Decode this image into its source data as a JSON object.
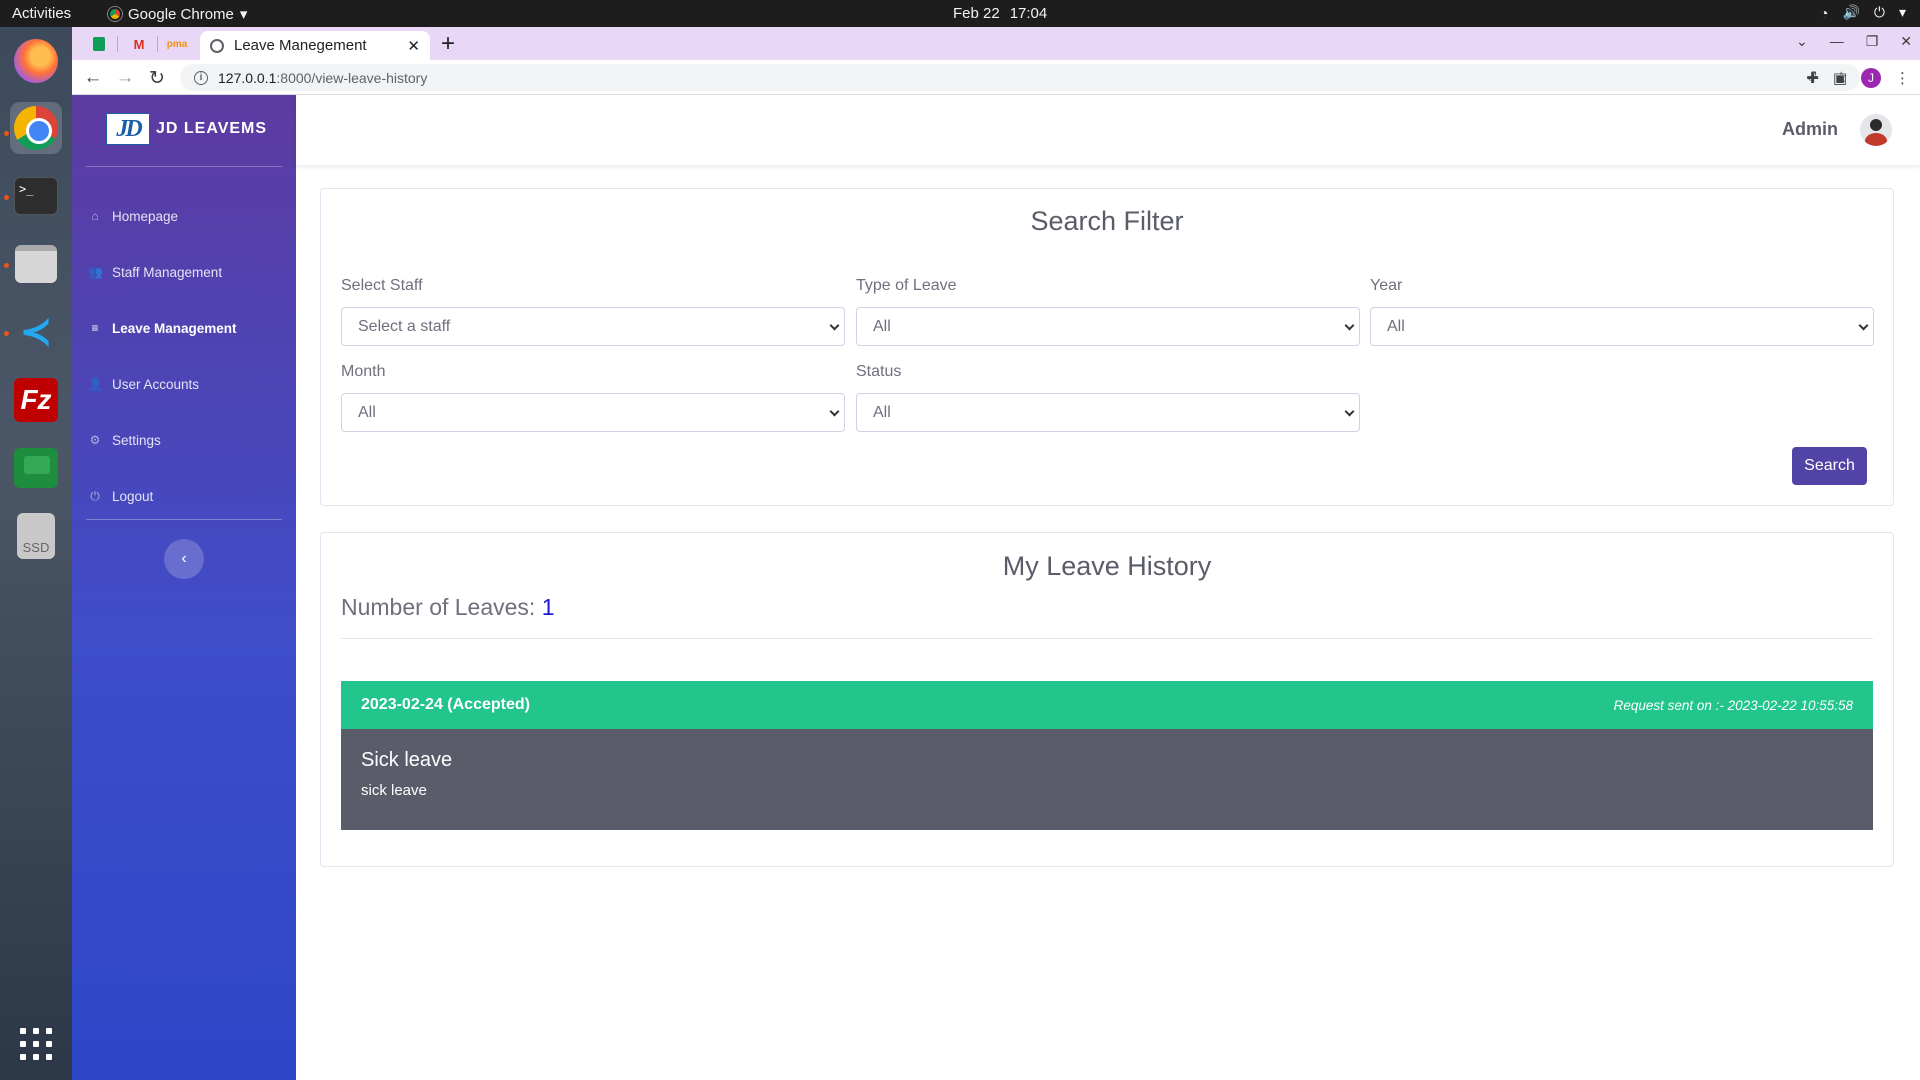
{
  "os": {
    "activities": "Activities",
    "app_name": "Google Chrome",
    "date": "Feb 22",
    "time": "17:04",
    "dock_items": [
      "firefox-icon",
      "chrome-icon",
      "terminal-icon",
      "files-icon",
      "vscode-icon",
      "filezilla-icon",
      "google-chat-icon",
      "ssd-icon",
      "app-grid-icon"
    ],
    "dock_ssd_label": "SSD",
    "dock_terminal_text": ">_",
    "dock_fz_text": "Fz"
  },
  "browser": {
    "pinned_tabs": [
      "google-sheets-icon",
      "gmail-icon",
      "phpmyadmin-icon"
    ],
    "pinned_gmail_letter": "M",
    "pinned_pma_text": "pma",
    "tab_title": "Leave Manegement",
    "tab_close": "✕",
    "new_tab": "+",
    "url_host": "127.0.0.1",
    "url_path": ":8000/view-leave-history",
    "profile_initial": "J"
  },
  "app": {
    "brand_logo_text": "JD",
    "brand_name": "JD LEAVEMS",
    "nav": [
      {
        "label": "Homepage",
        "icon": "home-icon",
        "glyph": "⌂",
        "active": false
      },
      {
        "label": "Staff Management",
        "icon": "users-icon",
        "glyph": "👥",
        "active": false
      },
      {
        "label": "Leave Management",
        "icon": "database-icon",
        "glyph": "≡",
        "active": true
      },
      {
        "label": "User Accounts",
        "icon": "user-icon",
        "glyph": "👤",
        "active": false
      },
      {
        "label": "Settings",
        "icon": "gear-icon",
        "glyph": "⚙",
        "active": false
      },
      {
        "label": "Logout",
        "icon": "power-icon",
        "glyph": "⏻",
        "active": false
      }
    ],
    "collapse_glyph": "‹",
    "user_name": "Admin"
  },
  "filter": {
    "title": "Search Filter",
    "staff_label": "Select Staff",
    "staff_value": "Select a staff",
    "type_label": "Type of Leave",
    "type_value": "All",
    "year_label": "Year",
    "year_value": "All",
    "month_label": "Month",
    "month_value": "All",
    "status_label": "Status",
    "status_value": "All",
    "search_button": "Search"
  },
  "history": {
    "title": "My Leave History",
    "count_label": "Number of Leaves:",
    "count_value": "1",
    "leaves": [
      {
        "date_status": "2023-02-24 (Accepted)",
        "request_sent": "Request sent on :- 2023-02-22 10:55:58",
        "type": "Sick leave",
        "reason": "sick leave",
        "status_color": "#22c58b"
      }
    ]
  },
  "colors": {
    "sidebar_top": "#5c3ba0",
    "sidebar_bottom": "#2d46c8",
    "primary_button": "#5144a6",
    "accepted": "#22c58b",
    "leave_body": "#5a5c69"
  }
}
